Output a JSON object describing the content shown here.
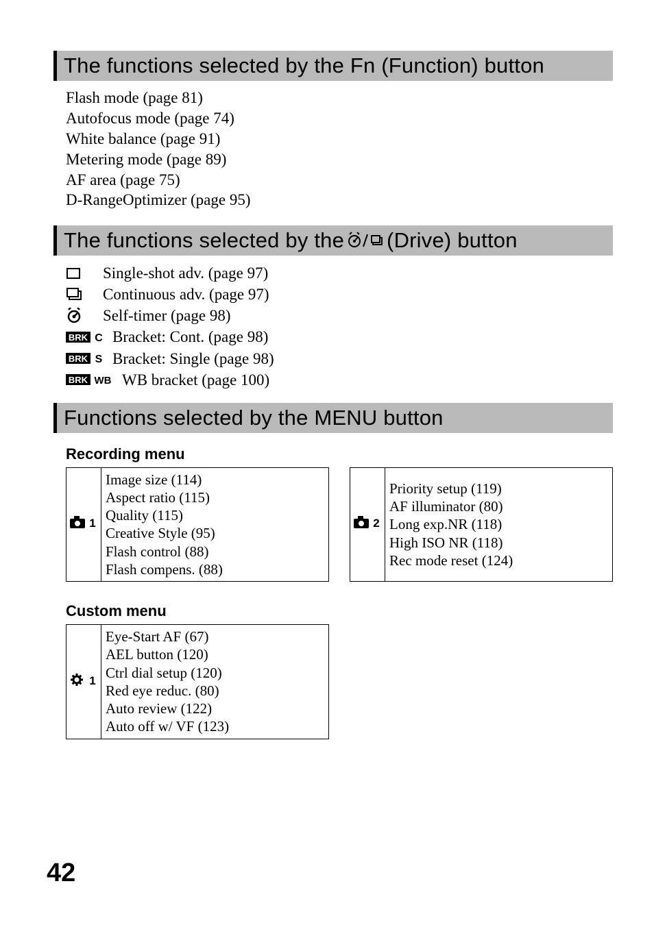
{
  "page_number": "42",
  "section1": {
    "title": "The functions selected by the Fn (Function) button",
    "lines": [
      "Flash mode (page 81)",
      "Autofocus mode (page 74)",
      "White balance (page 91)",
      "Metering mode (page 89)",
      "AF area (page 75)",
      "D-RangeOptimizer (page 95)"
    ]
  },
  "section2": {
    "title_pre": "The functions selected by the ",
    "title_post": " (Drive) button",
    "items": [
      {
        "label": "Single-shot adv. (page 97)"
      },
      {
        "label": "Continuous adv. (page 97)"
      },
      {
        "label": "Self-timer (page 98)"
      },
      {
        "label": "Bracket: Cont. (page 98)"
      },
      {
        "label": "Bracket: Single (page 98)"
      },
      {
        "label": "WB bracket (page 100)"
      }
    ]
  },
  "section3": {
    "title": "Functions selected by the MENU button",
    "recording": {
      "heading": "Recording menu",
      "left": [
        "Image size (114)",
        "Aspect ratio (115)",
        "Quality (115)",
        "Creative Style (95)",
        "Flash control (88)",
        "Flash compens. (88)"
      ],
      "right": [
        "Priority setup (119)",
        "AF illuminator (80)",
        "Long exp.NR (118)",
        "High ISO NR (118)",
        "Rec mode reset (124)",
        ""
      ],
      "icon_left_num": "1",
      "icon_right_num": "2"
    },
    "custom": {
      "heading": "Custom menu",
      "items": [
        "Eye-Start AF (67)",
        "AEL button (120)",
        "Ctrl dial setup (120)",
        "Red eye reduc. (80)",
        "Auto review (122)",
        "Auto off w/ VF (123)"
      ],
      "icon_num": "1"
    }
  }
}
